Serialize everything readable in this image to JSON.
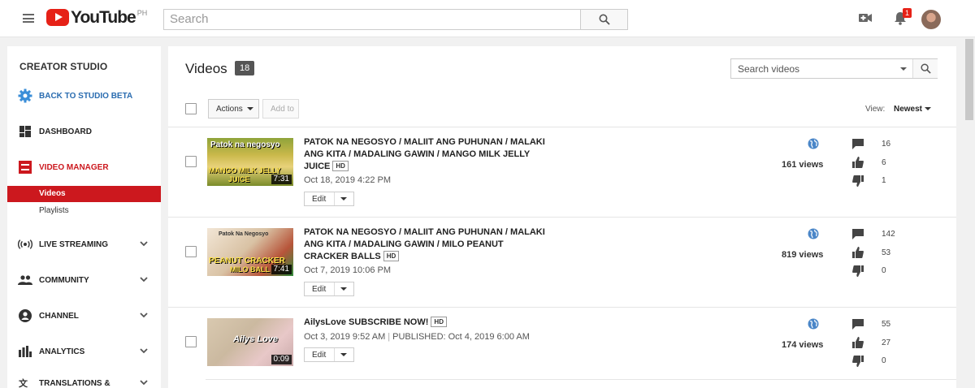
{
  "header": {
    "logo_text": "YouTube",
    "region": "PH",
    "search_placeholder": "Search",
    "notification_count": "1"
  },
  "sidebar": {
    "title": "CREATOR STUDIO",
    "items": [
      {
        "label": "BACK TO STUDIO BETA",
        "icon": "gear-icon"
      },
      {
        "label": "DASHBOARD",
        "icon": "dashboard-icon"
      },
      {
        "label": "VIDEO MANAGER",
        "icon": "video-manager-icon"
      },
      {
        "label": "LIVE STREAMING",
        "icon": "live-icon"
      },
      {
        "label": "COMMUNITY",
        "icon": "community-icon"
      },
      {
        "label": "CHANNEL",
        "icon": "channel-icon"
      },
      {
        "label": "ANALYTICS",
        "icon": "analytics-icon"
      },
      {
        "label": "TRANSLATIONS &",
        "icon": "translations-icon"
      }
    ],
    "sub_items": [
      "Videos",
      "Playlists"
    ]
  },
  "main": {
    "title": "Videos",
    "count": "18",
    "search_placeholder": "Search videos",
    "actions_label": "Actions",
    "add_to_label": "Add to",
    "view_label": "View:",
    "view_value": "Newest",
    "edit_label": "Edit",
    "hd_label": "HD"
  },
  "videos": [
    {
      "title": "PATOK NA NEGOSYO / MALIIT ANG PUHUNAN / MALAKI ANG KITA / MADALING GAWIN / MANGO MILK JELLY JUICE",
      "date": "Oct 18, 2019 4:22 PM",
      "published": "",
      "duration": "7:31",
      "views": "161 views",
      "comments": "16",
      "likes": "6",
      "dislikes": "1",
      "thumb_text": [
        "Patok na negosyo",
        "MANGO MILK JELLY",
        "JUICE"
      ]
    },
    {
      "title": "PATOK NA NEGOSYO / MALIIT ANG PUHUNAN / MALAKI ANG KITA / MADALING GAWIN / MILO PEANUT CRACKER BALLS",
      "date": "Oct 7, 2019 10:06 PM",
      "published": "",
      "duration": "7:41",
      "views": "819 views",
      "comments": "142",
      "likes": "53",
      "dislikes": "0",
      "thumb_text": [
        "Patok Na Negosyo",
        "PEANUT CRACKER",
        "MILO BALL"
      ]
    },
    {
      "title": "AilysLove SUBSCRIBE NOW!",
      "date": "Oct 3, 2019 9:52 AM",
      "published": "PUBLISHED: Oct 4, 2019 6:00 AM",
      "duration": "0:09",
      "views": "174 views",
      "comments": "55",
      "likes": "27",
      "dislikes": "0",
      "thumb_text": [
        "Ailys Love"
      ]
    }
  ]
}
